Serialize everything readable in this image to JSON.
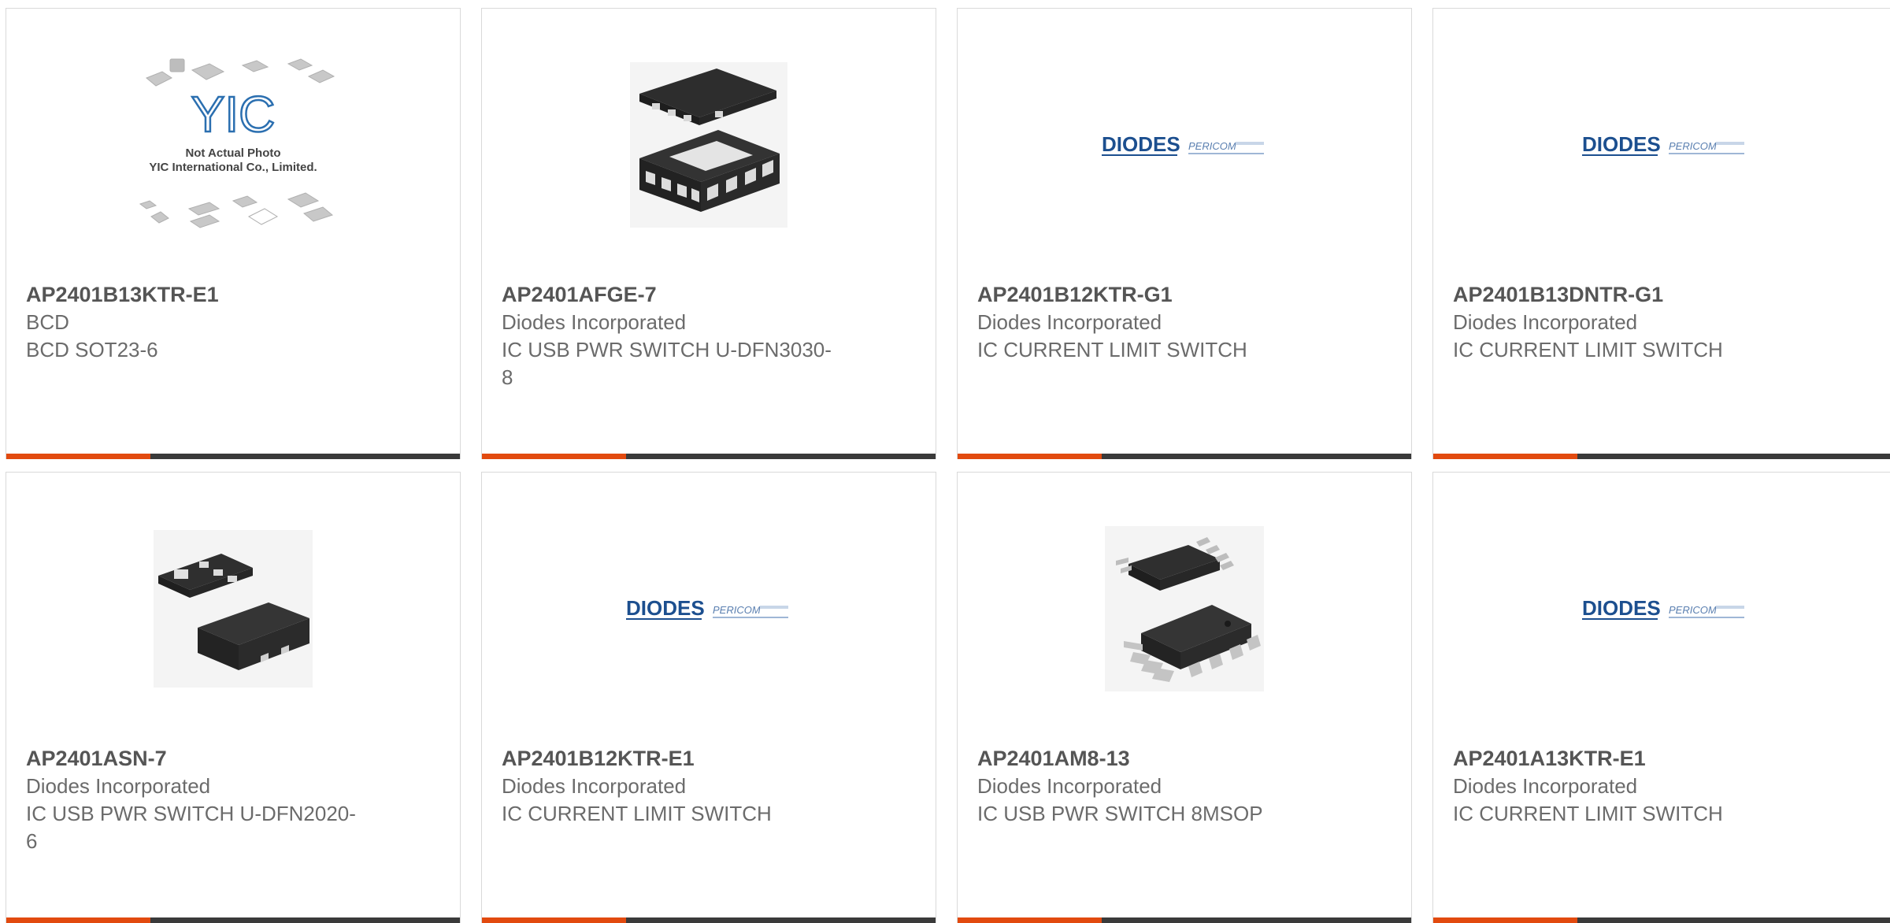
{
  "products": [
    {
      "part_number": "AP2401B13KTR-E1",
      "manufacturer": "BCD",
      "description": "BCD SOT23-6",
      "image": "placeholder-yic-logo",
      "image_text_line1": "Not Actual Photo",
      "image_text_line2": "YIC International Co., Limited.",
      "image_logo_text": "YIC"
    },
    {
      "part_number": "AP2401AFGE-7",
      "manufacturer": "Diodes Incorporated",
      "description": "IC USB PWR SWITCH U-DFN3030-8",
      "image": "dfn8-chip-photo"
    },
    {
      "part_number": "AP2401B12KTR-G1",
      "manufacturer": "Diodes Incorporated",
      "description": "IC CURRENT LIMIT SWITCH",
      "image": "diodes-pericom-logo",
      "logo_text_1": "DIODES",
      "logo_text_2": "PERICOM"
    },
    {
      "part_number": "AP2401B13DNTR-G1",
      "manufacturer": "Diodes Incorporated",
      "description": "IC CURRENT LIMIT SWITCH",
      "image": "diodes-pericom-logo",
      "logo_text_1": "DIODES",
      "logo_text_2": "PERICOM"
    },
    {
      "part_number": "AP2401ASN-7",
      "manufacturer": "Diodes Incorporated",
      "description": "IC USB PWR SWITCH U-DFN2020-6",
      "image": "dfn6-chip-photo"
    },
    {
      "part_number": "AP2401B12KTR-E1",
      "manufacturer": "Diodes Incorporated",
      "description": "IC CURRENT LIMIT SWITCH",
      "image": "diodes-pericom-logo",
      "logo_text_1": "DIODES",
      "logo_text_2": "PERICOM"
    },
    {
      "part_number": "AP2401AM8-13",
      "manufacturer": "Diodes Incorporated",
      "description": "IC USB PWR SWITCH 8MSOP",
      "image": "msop8-chip-photo"
    },
    {
      "part_number": "AP2401A13KTR-E1",
      "manufacturer": "Diodes Incorporated",
      "description": "IC CURRENT LIMIT SWITCH",
      "image": "diodes-pericom-logo",
      "logo_text_1": "DIODES",
      "logo_text_2": "PERICOM"
    }
  ],
  "colors": {
    "accent": "#e24a0f",
    "bar": "#3a3a3a",
    "text": "#6b6b6b",
    "logo_blue": "#1c4f8f",
    "yic_blue": "#2b6fb0"
  }
}
